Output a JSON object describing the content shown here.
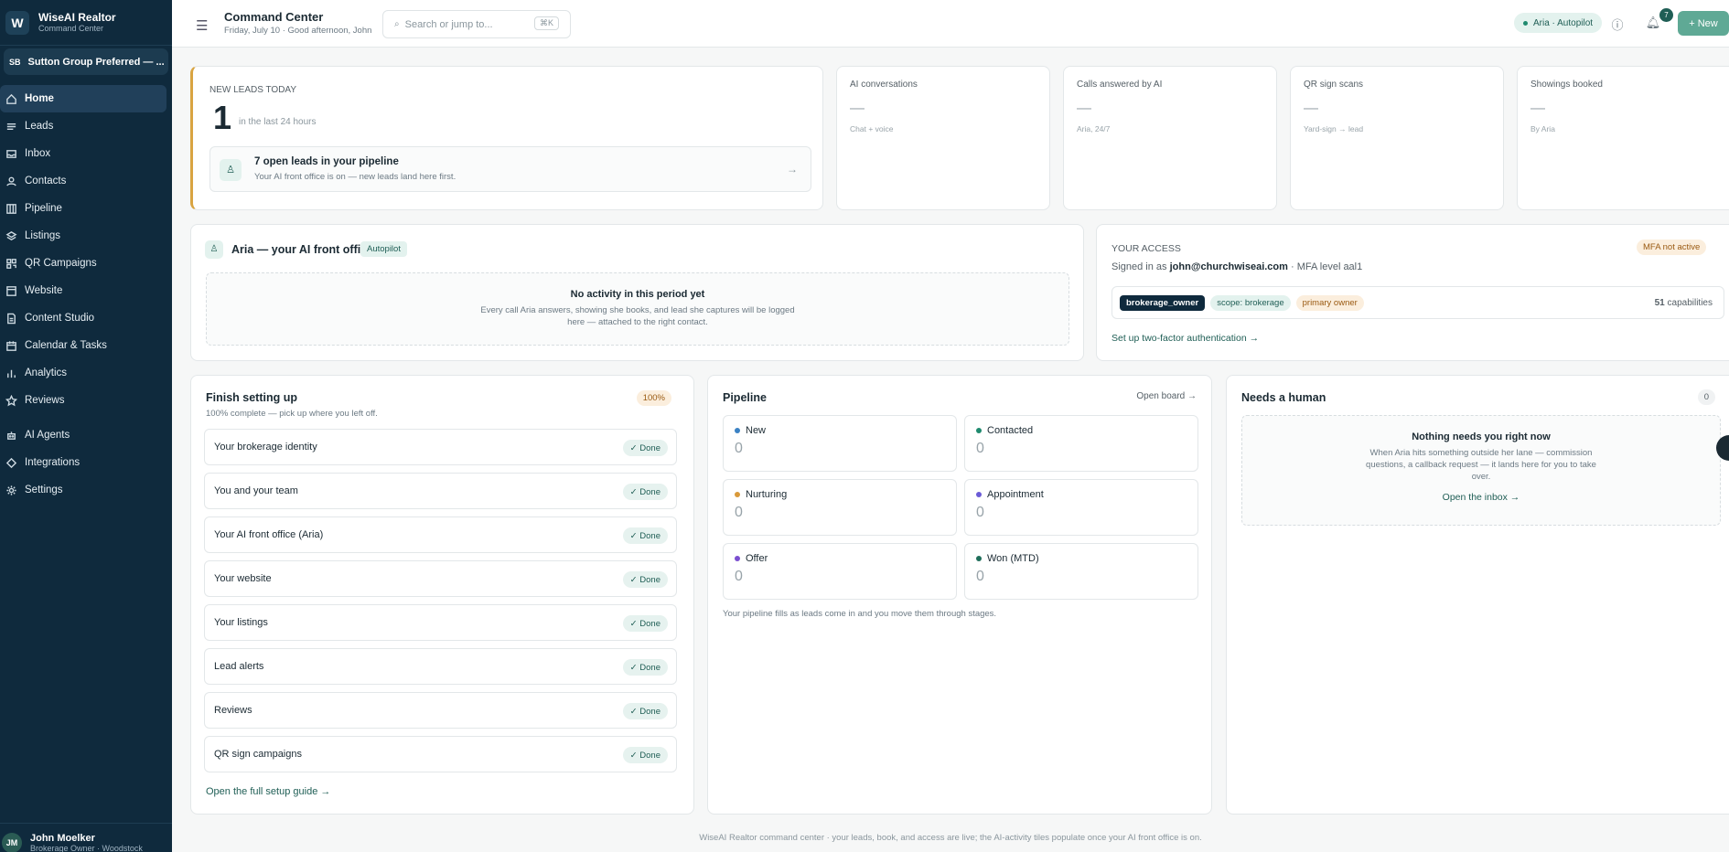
{
  "app": {
    "name": "WiseAI Realtor",
    "subtitle": "Command Center",
    "logo_letter": "W"
  },
  "org": {
    "initials": "SB",
    "name": "Sutton Group Preferred — ..."
  },
  "sidebar": {
    "items": [
      {
        "label": "Home",
        "icon": "home-icon"
      },
      {
        "label": "Leads",
        "icon": "list-icon"
      },
      {
        "label": "Inbox",
        "icon": "inbox-icon"
      },
      {
        "label": "Contacts",
        "icon": "person-icon"
      },
      {
        "label": "Pipeline",
        "icon": "columns-icon"
      },
      {
        "label": "Listings",
        "icon": "layers-icon"
      },
      {
        "label": "QR Campaigns",
        "icon": "qr-icon"
      },
      {
        "label": "Website",
        "icon": "browser-icon"
      },
      {
        "label": "Content Studio",
        "icon": "document-icon"
      },
      {
        "label": "Calendar & Tasks",
        "icon": "calendar-icon"
      },
      {
        "label": "Analytics",
        "icon": "bar-chart-icon"
      },
      {
        "label": "Reviews",
        "icon": "star-icon"
      },
      {
        "label": "AI Agents",
        "icon": "bot-icon"
      },
      {
        "label": "Integrations",
        "icon": "plug-icon"
      },
      {
        "label": "Settings",
        "icon": "gear-icon"
      }
    ]
  },
  "user": {
    "initials": "JM",
    "name": "John Moelker",
    "role": "Brokerage Owner · Woodstock"
  },
  "header": {
    "title": "Command Center",
    "subtitle": "Friday, July 10 · Good afternoon, John",
    "search_placeholder": "Search or jump to...",
    "search_shortcut": "⌘K",
    "status_pill": "Aria · Autopilot",
    "notification_count": "7",
    "new_button": "+ New"
  },
  "new_leads": {
    "label": "NEW LEADS TODAY",
    "count": "1",
    "period": "in the last 24 hours",
    "pipeline_title": "7 open leads in your pipeline",
    "pipeline_sub": "Your AI front office is on — new leads land here first.",
    "arrow": "→"
  },
  "kpis": [
    {
      "label": "AI conversations",
      "value": "—",
      "sub": "Chat + voice"
    },
    {
      "label": "Calls answered by AI",
      "value": "—",
      "sub": "Aria, 24/7"
    },
    {
      "label": "QR sign scans",
      "value": "—",
      "sub": "Yard-sign → lead"
    },
    {
      "label": "Showings booked",
      "value": "—",
      "sub": "By Aria"
    }
  ],
  "aria": {
    "title": "Aria — your AI front office",
    "badge": "Autopilot",
    "empty_title": "No activity in this period yet",
    "empty_text": "Every call Aria answers, showing she books, and lead she captures will be logged here — attached to the right contact."
  },
  "access": {
    "label": "YOUR ACCESS",
    "mfa_badge": "MFA not active",
    "signed_prefix": "Signed in as",
    "email": "john@churchwiseai.com",
    "mfa_level": "· MFA level aal1",
    "tags": [
      "brokerage_owner",
      "scope: brokerage",
      "primary owner"
    ],
    "capabilities_count": "51",
    "capabilities_label": "capabilities",
    "link": "Set up two-factor authentication →"
  },
  "setup": {
    "title": "Finish setting up",
    "percent": "100%",
    "subtitle": "100% complete — pick up where you left off.",
    "done_label": "Done",
    "items": [
      "Your brokerage identity",
      "You and your team",
      "Your AI front office (Aria)",
      "Your website",
      "Your listings",
      "Lead alerts",
      "Reviews",
      "QR sign campaigns"
    ],
    "link": "Open the full setup guide →"
  },
  "pipeline": {
    "title": "Pipeline",
    "open_board": "Open board →",
    "stages": [
      {
        "label": "New",
        "value": "0",
        "color": "#3b82c4"
      },
      {
        "label": "Contacted",
        "value": "0",
        "color": "#1f8a6e"
      },
      {
        "label": "Nurturing",
        "value": "0",
        "color": "#d99a3a"
      },
      {
        "label": "Appointment",
        "value": "0",
        "color": "#6b5bd6"
      },
      {
        "label": "Offer",
        "value": "0",
        "color": "#7b4fd0"
      },
      {
        "label": "Won (MTD)",
        "value": "0",
        "color": "#1f6e5a"
      }
    ],
    "note": "Your pipeline fills as leads come in and you move them through stages."
  },
  "needs_human": {
    "title": "Needs a human",
    "count": "0",
    "empty_title": "Nothing needs you right now",
    "empty_text": "When Aria hits something outside her lane — commission questions, a callback request — it lands here for you to take over.",
    "link": "Open the inbox →"
  },
  "footer": "WiseAI Realtor command center · your leads, book, and access are live; the AI-activity tiles populate once your AI front office is on."
}
